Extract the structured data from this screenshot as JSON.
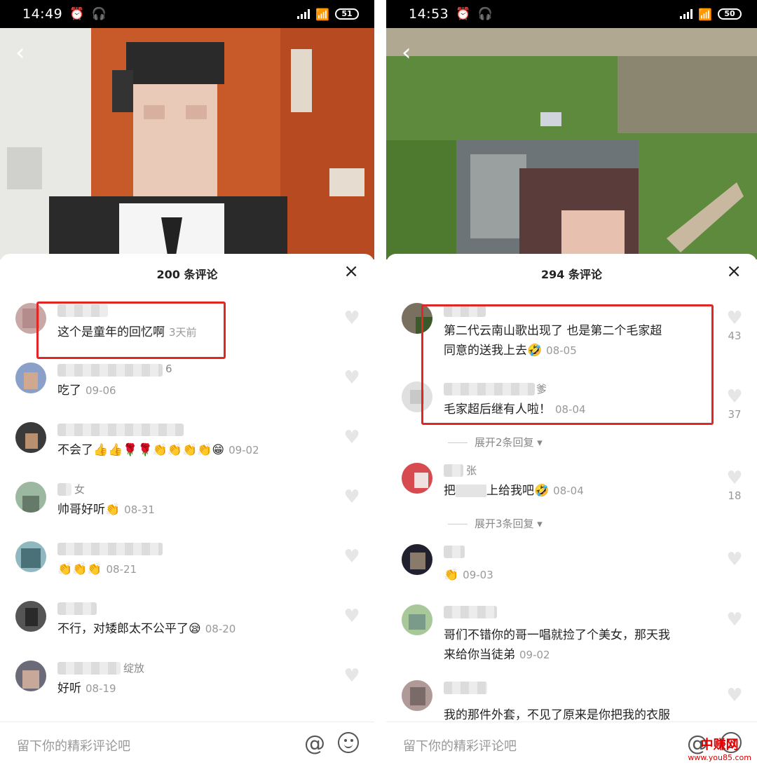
{
  "status_bars": [
    {
      "time": "14:49",
      "battery": "51"
    },
    {
      "time": "14:53",
      "battery": "50"
    }
  ],
  "left": {
    "sheet_title": "200 条评论",
    "close": "×",
    "input_placeholder": "留下你的精彩评论吧",
    "comments": [
      {
        "text": "这个是童年的回忆啊",
        "date": "3天前",
        "user_suffix": ""
      },
      {
        "text": "吃了",
        "date": "09-06",
        "user_suffix": "6"
      },
      {
        "text": "不会了👍👍🌹🌹👏👏👏👏😁",
        "date": "09-02",
        "user_suffix": ""
      },
      {
        "text": "帅哥好听👏",
        "date": "08-31",
        "user_suffix": "女"
      },
      {
        "text": "👏👏👏",
        "date": "08-21",
        "user_suffix": ""
      },
      {
        "text": "不行，对矮郎太不公平了😪",
        "date": "08-20",
        "user_suffix": ""
      },
      {
        "text": "好听",
        "date": "08-19",
        "user_suffix": "绽放"
      }
    ]
  },
  "right": {
    "sheet_title": "294 条评论",
    "close": "×",
    "input_placeholder": "留下你的精彩评论吧",
    "comments": [
      {
        "line1": "第二代云南山歌出现了 也是第二个毛家超",
        "line2": "同意的送我上去🤣",
        "date": "08-05",
        "likes": "43"
      },
      {
        "line1": "毛家超后继有人啦！",
        "date": "08-04",
        "likes": "37",
        "user_suffix": "爹"
      },
      {
        "line1": "把",
        "line1b": "上给我吧🤣",
        "date": "08-04",
        "likes": "18",
        "user_suffix": "张"
      },
      {
        "line1": "👏",
        "date": "09-03"
      },
      {
        "line1": "哥们不错你的哥一唱就捡了个美女，那天我",
        "line2": "来给你当徒弟",
        "date": "09-02"
      },
      {
        "line1": "我的那件外套，不见了原来是你把我的衣服",
        "date": ""
      }
    ],
    "expand_replies": [
      "展开2条回复 ▾",
      "展开3条回复 ▾"
    ]
  },
  "watermark": {
    "top": "中赚网",
    "bottom": "www.you85.com"
  },
  "colors": {
    "highlight": "#e22525",
    "date": "#999999",
    "heart": "#e6e6e6"
  }
}
